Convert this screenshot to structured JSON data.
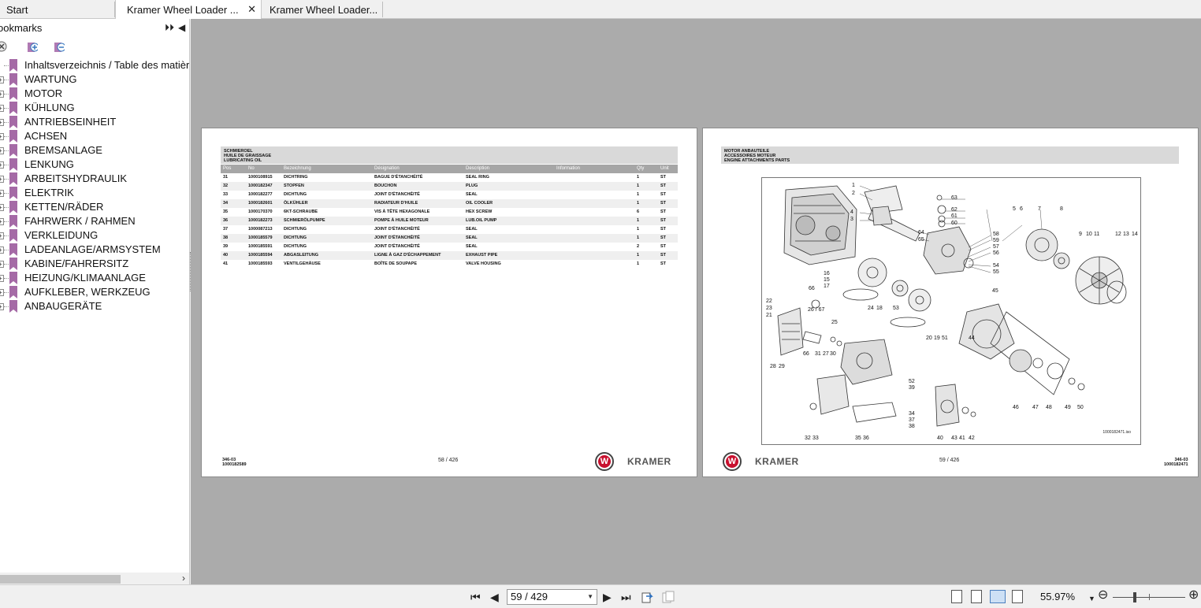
{
  "tabs": [
    {
      "label": "Start"
    },
    {
      "label": "Kramer Wheel Loader ...",
      "close": "✕"
    },
    {
      "label": "Kramer Wheel Loader..."
    }
  ],
  "sidebar": {
    "title": "ookmarks",
    "bookmarks": [
      "Inhaltsverzeichnis / Table des matières",
      "WARTUNG",
      "MOTOR",
      "KÜHLUNG",
      "ANTRIEBSEINHEIT",
      "ACHSEN",
      "BREMSANLAGE",
      "LENKUNG",
      "ARBEITSHYDRAULIK",
      "ELEKTRIK",
      "KETTEN/RÄDER",
      "FAHRWERK / RAHMEN",
      "VERKLEIDUNG",
      "LADEANLAGE/ARMSYSTEM",
      "KABINE/FAHRERSITZ",
      "HEIZUNG/KLIMAANLAGE",
      "AUFKLEBER, WERKZEUG",
      "ANBAUGERÄTE"
    ]
  },
  "page58": {
    "header": [
      "SCHMIEROEL",
      "HUILE DE GRAISSAGE",
      "LUBRICATING OIL"
    ],
    "columns": [
      "Pos",
      "No",
      "Bezeichnung",
      "Désignation",
      "Description",
      "Information",
      "Qty",
      "Unit"
    ],
    "rows": [
      [
        "31",
        "1000108915",
        "DICHTRING",
        "BAGUE D'ÉTANCHÉITÉ",
        "SEAL RING",
        "",
        "1",
        "ST"
      ],
      [
        "32",
        "1000182347",
        "STOPFEN",
        "BOUCHON",
        "PLUG",
        "",
        "1",
        "ST"
      ],
      [
        "33",
        "1000182277",
        "DICHTUNG",
        "JOINT D'ÉTANCHÉITÉ",
        "SEAL",
        "",
        "1",
        "ST"
      ],
      [
        "34",
        "1000182601",
        "ÖLKÜHLER",
        "RADIATEUR D'HUILE",
        "OIL COOLER",
        "",
        "1",
        "ST"
      ],
      [
        "35",
        "1000170370",
        "6KT-SCHRAUBE",
        "VIS À TÊTE HEXAGONALE",
        "HEX SCREW",
        "",
        "6",
        "ST"
      ],
      [
        "36",
        "1000182273",
        "SCHMIERÖLPUMPE",
        "POMPE À HUILE MOTEUR",
        "LUB.OIL PUMP",
        "",
        "1",
        "ST"
      ],
      [
        "37",
        "1000087213",
        "DICHTUNG",
        "JOINT D'ÉTANCHÉITÉ",
        "SEAL",
        "",
        "1",
        "ST"
      ],
      [
        "38",
        "1000185579",
        "DICHTUNG",
        "JOINT D'ÉTANCHÉITÉ",
        "SEAL",
        "",
        "1",
        "ST"
      ],
      [
        "39",
        "1000185591",
        "DICHTUNG",
        "JOINT D'ÉTANCHÉITÉ",
        "SEAL",
        "",
        "2",
        "ST"
      ],
      [
        "40",
        "1000185594",
        "ABGASLEITUNG",
        "LIGNE À GAZ D'ÉCHAPPEMENT",
        "EXHAUST PIPE",
        "",
        "1",
        "ST"
      ],
      [
        "41",
        "1000185593",
        "VENTILGEHÄUSE",
        "BOÎTE DE SOUPAPE",
        "VALVE HOUSING",
        "",
        "1",
        "ST"
      ]
    ],
    "footer_code": [
      "346-03",
      "1000182589"
    ],
    "page_label": "58 / 426",
    "brand": "KRAMER"
  },
  "page59": {
    "header": [
      "MOTOR ANBAUTEILE",
      "ACCESSOIRES MOTEUR",
      "ENGINE ATTACHMENTS PARTS"
    ],
    "callouts": [
      {
        "t": "1"
      },
      {
        "t": "2"
      },
      {
        "t": "4"
      },
      {
        "t": "3"
      },
      {
        "t": "63"
      },
      {
        "t": "62"
      },
      {
        "t": "61"
      },
      {
        "t": "60"
      },
      {
        "t": "5"
      },
      {
        "t": "6"
      },
      {
        "t": "7"
      },
      {
        "t": "8"
      },
      {
        "t": "64"
      },
      {
        "t": "65"
      },
      {
        "t": "58"
      },
      {
        "t": "59"
      },
      {
        "t": "57"
      },
      {
        "t": "56"
      },
      {
        "t": "54"
      },
      {
        "t": "55"
      },
      {
        "t": "9"
      },
      {
        "t": "10"
      },
      {
        "t": "11"
      },
      {
        "t": "12"
      },
      {
        "t": "13"
      },
      {
        "t": "14"
      },
      {
        "t": "16"
      },
      {
        "t": "15"
      },
      {
        "t": "17"
      },
      {
        "t": "66"
      },
      {
        "t": "45"
      },
      {
        "t": "22"
      },
      {
        "t": "23"
      },
      {
        "t": "21"
      },
      {
        "t": "26 / 67"
      },
      {
        "t": "24"
      },
      {
        "t": "18"
      },
      {
        "t": "53"
      },
      {
        "t": "25"
      },
      {
        "t": "20"
      },
      {
        "t": "19"
      },
      {
        "t": "51"
      },
      {
        "t": "44"
      },
      {
        "t": "28"
      },
      {
        "t": "29"
      },
      {
        "t": "66"
      },
      {
        "t": "31"
      },
      {
        "t": "27"
      },
      {
        "t": "30"
      },
      {
        "t": "52"
      },
      {
        "t": "39"
      },
      {
        "t": "46"
      },
      {
        "t": "47"
      },
      {
        "t": "48"
      },
      {
        "t": "49"
      },
      {
        "t": "50"
      },
      {
        "t": "34"
      },
      {
        "t": "37"
      },
      {
        "t": "38"
      },
      {
        "t": "32"
      },
      {
        "t": "33"
      },
      {
        "t": "35"
      },
      {
        "t": "36"
      },
      {
        "t": "40"
      },
      {
        "t": "43"
      },
      {
        "t": "41"
      },
      {
        "t": "42"
      }
    ],
    "diagram_code": "1000182471.iso",
    "footer_code": [
      "346-03",
      "1000182471"
    ],
    "page_label": "59 / 426",
    "brand": "KRAMER"
  },
  "toolbar": {
    "page_value": "59 / 429",
    "zoom": "55.97%"
  }
}
